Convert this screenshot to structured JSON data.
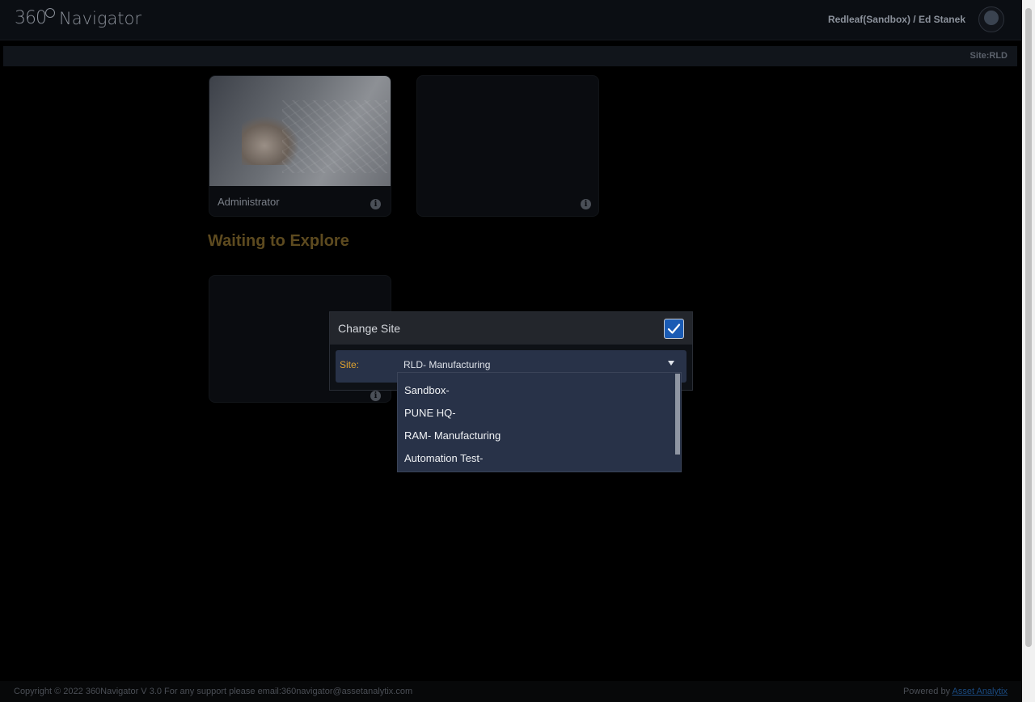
{
  "header": {
    "logo_number": "360",
    "logo_name": "Navigator",
    "user_label": "Redleaf(Sandbox) / Ed Stanek"
  },
  "subheader": {
    "site_label": "Site:RLD"
  },
  "tiles": [
    {
      "caption": "Administrator",
      "info_icon": "info-circle-icon"
    },
    {
      "caption": "",
      "info_icon": "info-circle-icon"
    },
    {
      "caption": "",
      "info_icon": "info-circle-icon"
    }
  ],
  "section": {
    "title": "Waiting to Explore"
  },
  "modal": {
    "title": "Change Site",
    "confirm_icon": "checkmark-icon",
    "field_label": "Site:",
    "selected_value": "RLD- Manufacturing",
    "options": [
      "Sandbox-",
      "PUNE HQ-",
      "RAM- Manufacturing",
      "Automation Test-"
    ]
  },
  "footer": {
    "copyright": "Copyright © 2022 360Navigator V 3.0",
    "support": "For any support please email:360navigator@assetanalytix.com",
    "powered_prefix": "Powered by",
    "powered_link": "Asset Analytix"
  },
  "colors": {
    "accent_blue": "#1a5bb4",
    "field_bg": "#283248",
    "label_orange": "#e0a32e",
    "section_title": "#5d4a1f"
  }
}
